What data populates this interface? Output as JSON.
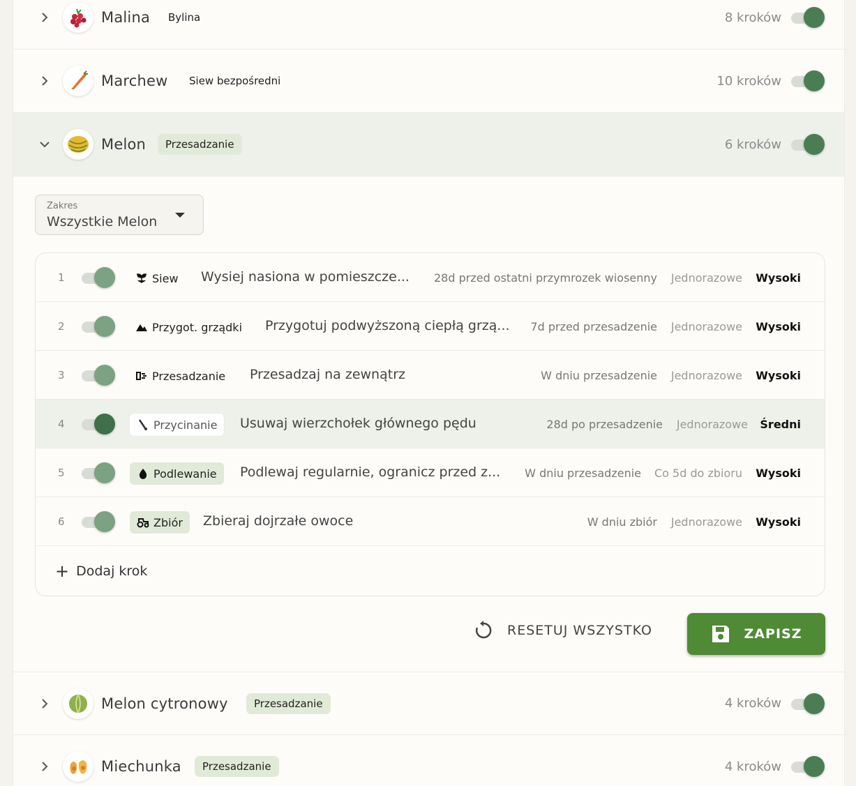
{
  "crops_top": [
    {
      "name": "Malina",
      "tag": "Bylina",
      "steps": "8 kroków"
    },
    {
      "name": "Marchew",
      "tag": "Siew bezpośredni",
      "steps": "10 kroków"
    }
  ],
  "expanded_crop": {
    "name": "Melon",
    "tag": "Przesadzanie",
    "steps": "6 kroków"
  },
  "scope": {
    "label": "Zakres",
    "value": "Wszystkie Melon"
  },
  "steps": [
    {
      "num": "1",
      "category": "Siew",
      "description": "Wysiej nasiona w pomieszcze...",
      "timing": "28d przed ostatni przymrozek wiosenny",
      "frequency": "Jednorazowe",
      "priority": "Wysoki"
    },
    {
      "num": "2",
      "category": "Przygot. grządki",
      "description": "Przygotuj podwyższoną ciepłą grzą...",
      "timing": "7d przed przesadzenie",
      "frequency": "Jednorazowe",
      "priority": "Wysoki"
    },
    {
      "num": "3",
      "category": "Przesadzanie",
      "description": "Przesadzaj na zewnątrz",
      "timing": "W dniu przesadzenie",
      "frequency": "Jednorazowe",
      "priority": "Wysoki"
    },
    {
      "num": "4",
      "category": "Przycinanie",
      "description": "Usuwaj wierzchołek głównego pędu",
      "timing": "28d po przesadzenie",
      "frequency": "Jednorazowe",
      "priority": "Średni"
    },
    {
      "num": "5",
      "category": "Podlewanie",
      "description": "Podlewaj regularnie, ogranicz przed z...",
      "timing": "W dniu przesadzenie",
      "frequency": "Co 5d do zbioru",
      "priority": "Wysoki"
    },
    {
      "num": "6",
      "category": "Zbiór",
      "description": "Zbieraj dojrzałe owoce",
      "timing": "W dniu zbiór",
      "frequency": "Jednorazowe",
      "priority": "Wysoki"
    }
  ],
  "add_step_label": "Dodaj krok",
  "reset_label": "RESETUJ WSZYSTKO",
  "save_label": "ZAPISZ",
  "crops_bottom": [
    {
      "name": "Melon cytronowy",
      "tag": "Przesadzanie",
      "steps": "4 kroków"
    },
    {
      "name": "Miechunka",
      "tag": "Przesadzanie",
      "steps": "4 kroków"
    }
  ],
  "colors": {
    "accent": "#4b7d55",
    "pill": "#e1ead8",
    "save": "#4f8a35"
  }
}
